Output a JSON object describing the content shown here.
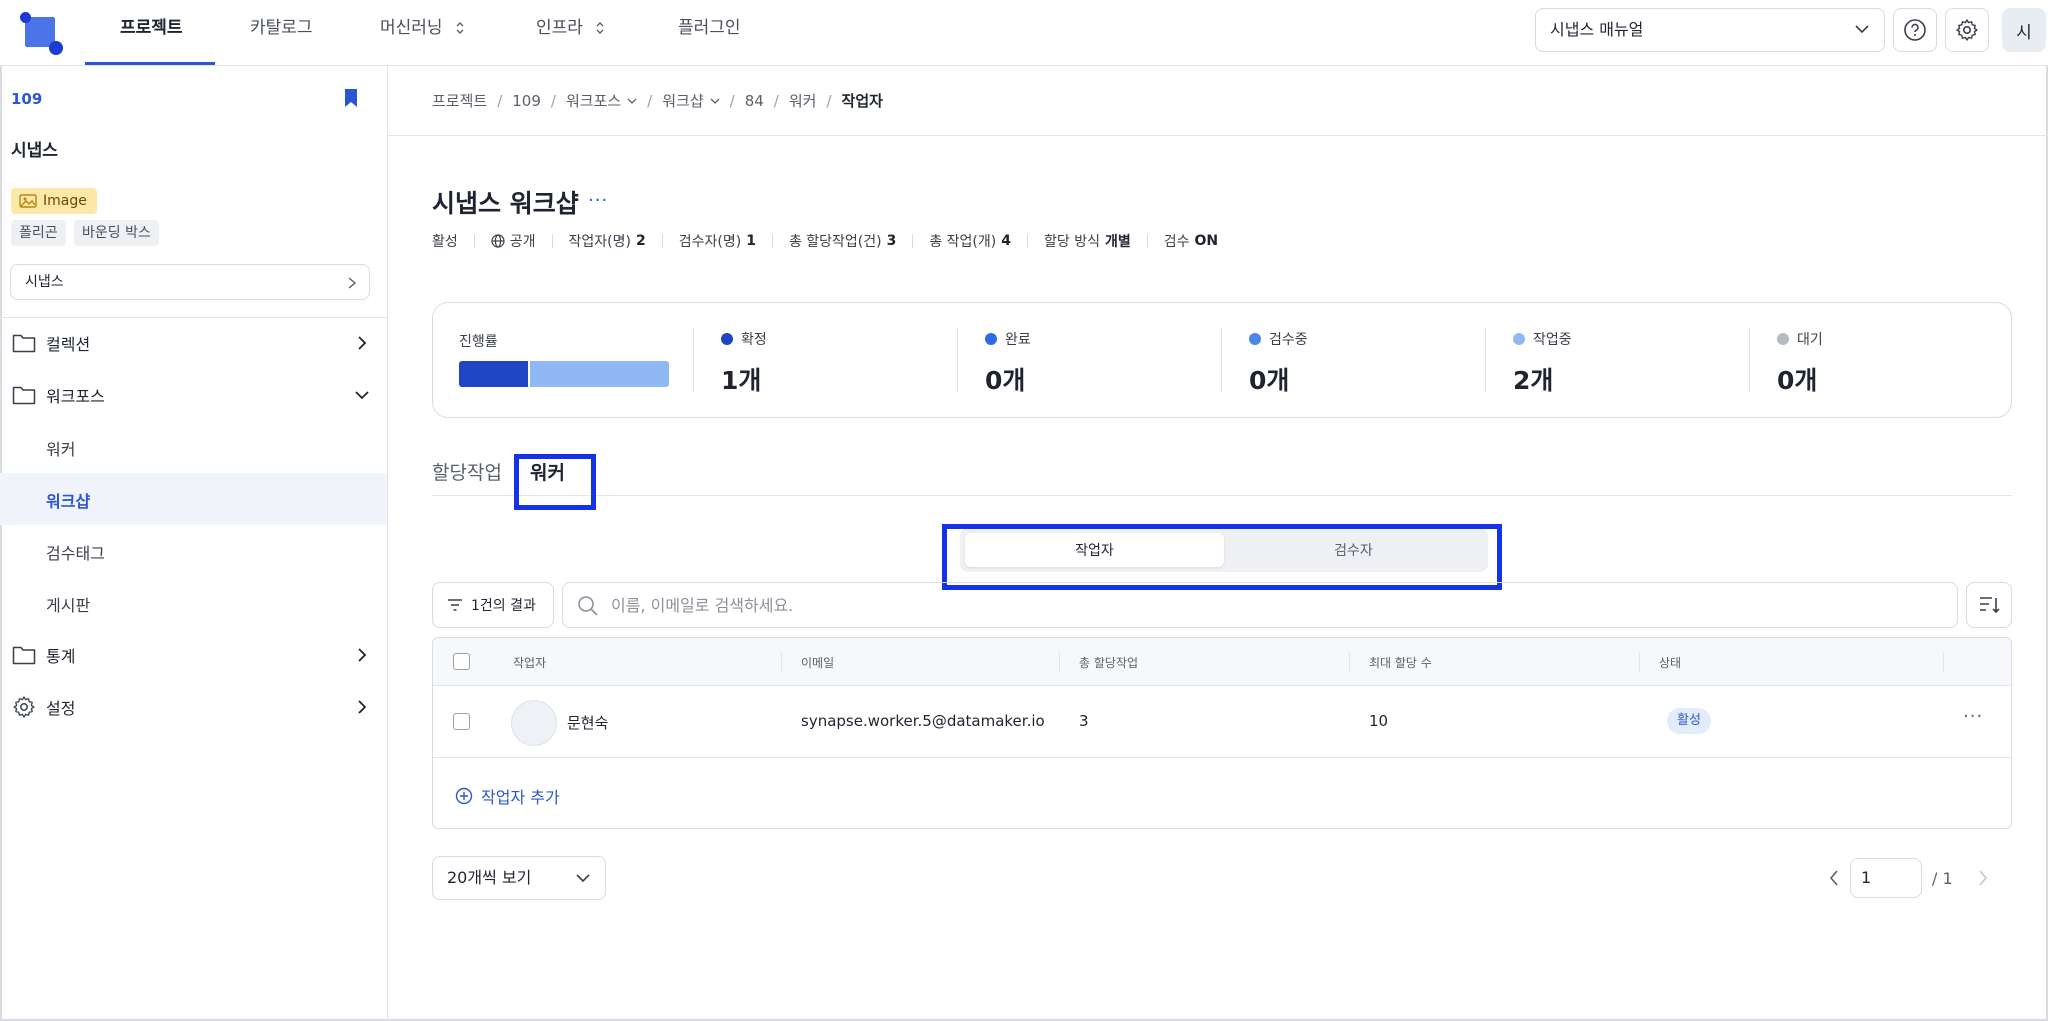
{
  "nav": {
    "items": [
      "프로젝트",
      "카탈로그",
      "머신러닝",
      "인프라",
      "플러그인"
    ],
    "project_select": "시냅스 매뉴얼",
    "avatar_initial": "시"
  },
  "sidebar": {
    "project_id": "109",
    "project_name": "시냅스",
    "image_tag": "Image",
    "chips": [
      "폴리곤",
      "바운딩 박스"
    ],
    "dataset_select": "시냅스",
    "items": [
      {
        "label": "컬렉션",
        "icon": "folder-icon"
      },
      {
        "label": "워크포스",
        "icon": "folder-icon"
      },
      {
        "label": "통계",
        "icon": "folder-icon"
      },
      {
        "label": "설정",
        "icon": "gear-icon"
      }
    ],
    "sub_items": [
      "워커",
      "워크샵",
      "검수태그",
      "게시판"
    ]
  },
  "breadcrumb": [
    "프로젝트",
    "109",
    "워크포스",
    "워크샵",
    "84",
    "워커",
    "작업자"
  ],
  "header": {
    "title": "시냅스 워크샵",
    "more": "···",
    "meta": {
      "status": "활성",
      "visibility": "공개",
      "workers_label": "작업자(명)",
      "workers_value": "2",
      "reviewers_label": "검수자(명)",
      "reviewers_value": "1",
      "assigned_label": "총 할당작업(건)",
      "assigned_value": "3",
      "tasks_label": "총 작업(개)",
      "tasks_value": "4",
      "assign_label": "할당 방식",
      "assign_value": "개별",
      "review_label": "검수",
      "review_value": "ON"
    }
  },
  "progress": {
    "label": "진행률",
    "bar": {
      "confirmed_fraction": 0.33,
      "working_fraction": 0.67
    },
    "stats": [
      {
        "label": "확정",
        "value": "1개",
        "color": "#1f45c4"
      },
      {
        "label": "완료",
        "value": "0개",
        "color": "#2f6be6"
      },
      {
        "label": "검수중",
        "value": "0개",
        "color": "#4b86e8"
      },
      {
        "label": "작업중",
        "value": "2개",
        "color": "#8fb8f5"
      },
      {
        "label": "대기",
        "value": "0개",
        "color": "#b5bac3"
      }
    ]
  },
  "tabs": [
    "할당작업",
    "워커"
  ],
  "segment": [
    "작업자",
    "검수자"
  ],
  "toolbar": {
    "result_label": "1건의 결과",
    "search_placeholder": "이름, 이메일로 검색하세요."
  },
  "table": {
    "headers": [
      "작업자",
      "이메일",
      "총 할당작업",
      "최대 할당 수",
      "상태"
    ],
    "rows": [
      {
        "name": "문현숙",
        "email": "synapse.worker.5@datamaker.io",
        "assigned": "3",
        "max": "10",
        "status": "활성"
      }
    ],
    "add_label": "작업자 추가"
  },
  "pagination": {
    "per_page": "20개씩 보기",
    "page": "1",
    "total": "/ 1"
  },
  "colors": {
    "accent": "#2a55d6",
    "highlight_box": "#1433e6"
  }
}
